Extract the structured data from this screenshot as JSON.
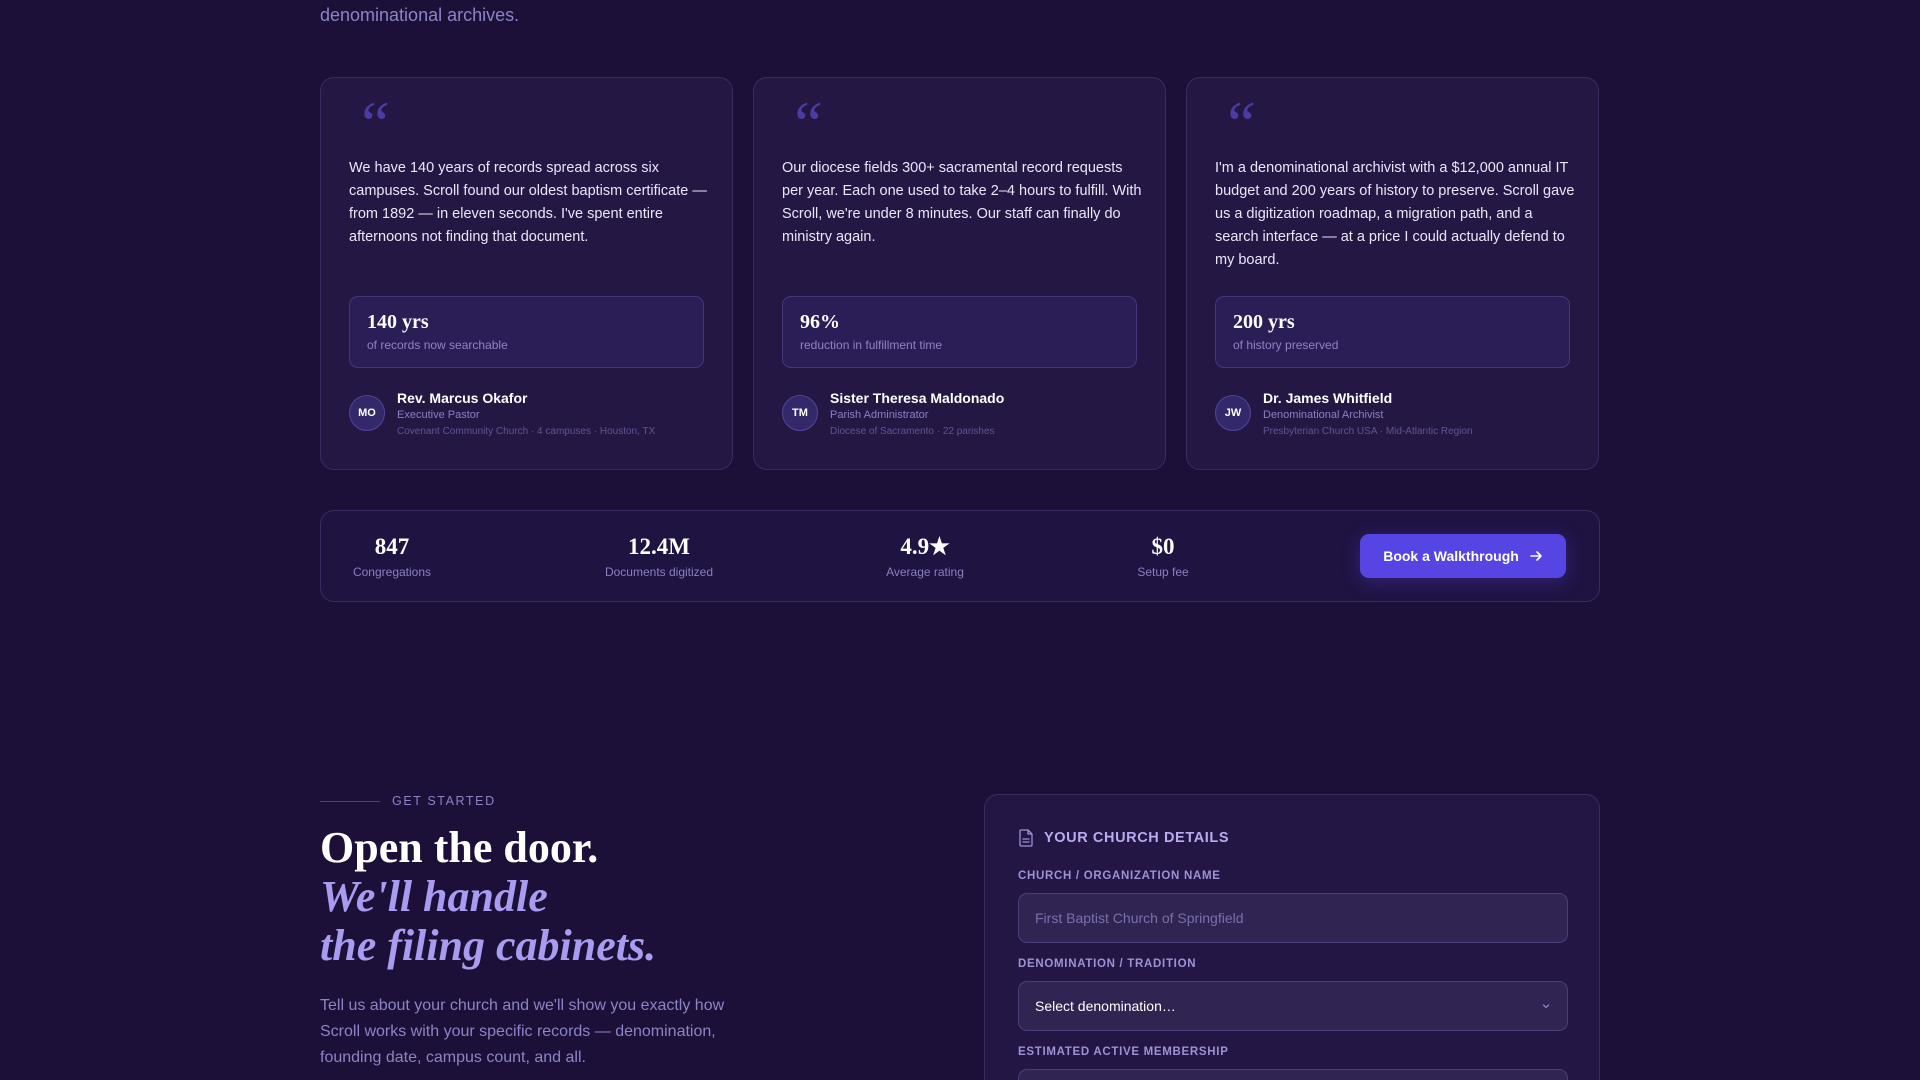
{
  "intro": {
    "tail_text": "denominational archives."
  },
  "testimonials": [
    {
      "quote": "We have 140 years of records spread across six campuses. Scroll found our oldest baptism certificate — from 1892 — in eleven seconds. I've spent entire afternoons not finding that document.",
      "metric_value": "140 yrs",
      "metric_label": "of records now searchable",
      "initials": "MO",
      "name": "Rev. Marcus Okafor",
      "role": "Executive Pastor",
      "org": "Covenant Community Church · 4 campuses · Houston, TX"
    },
    {
      "quote": "Our diocese fields 300+ sacramental record requests per year. Each one used to take 2–4 hours to fulfill. With Scroll, we're under 8 minutes. Our staff can finally do ministry again.",
      "metric_value": "96%",
      "metric_label": "reduction in fulfillment time",
      "initials": "TM",
      "name": "Sister Theresa Maldonado",
      "role": "Parish Administrator",
      "org": "Diocese of Sacramento · 22 parishes"
    },
    {
      "quote": "I'm a denominational archivist with a $12,000 annual IT budget and 200 years of history to preserve. Scroll gave us a digitization roadmap, a migration path, and a search interface — at a price I could actually defend to my board.",
      "metric_value": "200 yrs",
      "metric_label": "of history preserved",
      "initials": "JW",
      "name": "Dr. James Whitfield",
      "role": "Denominational Archivist",
      "org": "Presbyterian Church USA · Mid-Atlantic Region"
    }
  ],
  "quote_glyph": "“",
  "stats": [
    {
      "value": "847",
      "label": "Congregations"
    },
    {
      "value": "12.4M",
      "label": "Documents digitized"
    },
    {
      "value": "4.9★",
      "label": "Average rating"
    },
    {
      "value": "$0",
      "label": "Setup fee"
    }
  ],
  "cta": {
    "label": "Book a Walkthrough",
    "icon": "arrow-right-icon"
  },
  "get_started": {
    "eyebrow": "GET STARTED",
    "headline_1": "Open the door.",
    "headline_2": "We'll handle",
    "headline_3": "the filing cabinets.",
    "subcopy": "Tell us about your church and we'll show you exactly how Scroll works with your specific records — denomination, founding date, campus count, and all."
  },
  "form": {
    "title": "YOUR CHURCH DETAILS",
    "icon": "document-icon",
    "church_name_label": "CHURCH / ORGANIZATION NAME",
    "church_name_placeholder": "First Baptist Church of Springfield",
    "church_name_value": "",
    "denomination_label": "DENOMINATION / TRADITION",
    "denomination_value": "Select denomination…",
    "membership_label": "ESTIMATED ACTIVE MEMBERSHIP"
  },
  "colors": {
    "background": "#1c1038",
    "card": "#241744",
    "accent": "#5546e3",
    "accent_text": "#a89bf0"
  }
}
